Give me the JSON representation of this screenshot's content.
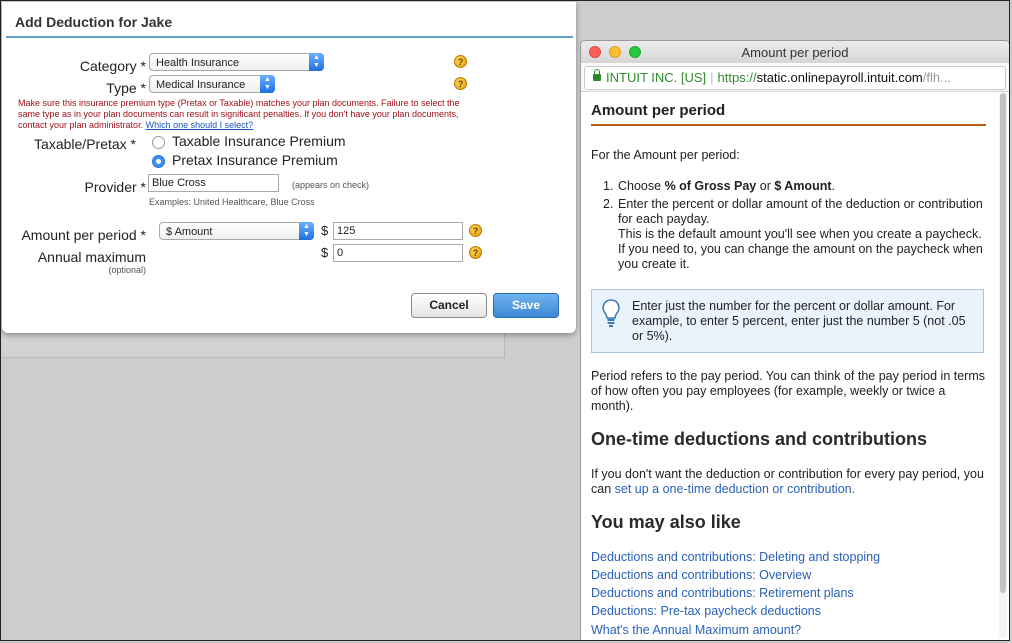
{
  "dialog": {
    "title": "Add Deduction for Jake",
    "category_label": "Category *",
    "category_value": "Health Insurance",
    "type_label": "Type *",
    "type_value": "Medical Insurance",
    "warning": "Make sure this insurance premium type (Pretax or Taxable) matches your plan documents. Failure to select the same type as in your plan documents can result in significant penalties. If you don't have your plan documents, contact your plan administrator.",
    "warning_link": "Which one should I select?",
    "taxable_label": "Taxable/Pretax *",
    "taxable_option": "Taxable Insurance Premium",
    "pretax_option": "Pretax Insurance Premium",
    "provider_label": "Provider *",
    "provider_value": "Blue Cross",
    "provider_note": "(appears on check)",
    "provider_examples": "Examples: United Healthcare, Blue Cross",
    "amount_label": "Amount per period *",
    "amount_type": "$ Amount",
    "currency": "$",
    "amount_value": "125",
    "annual_label": "Annual maximum",
    "annual_optional": "(optional)",
    "annual_value": "0",
    "help_glyph": "?",
    "cancel": "Cancel",
    "save": "Save"
  },
  "popup": {
    "window_title": "Amount per period",
    "url_org": "INTUIT INC. [US]",
    "url_scheme": "https://",
    "url_host": "static.onlinepayroll.intuit.com",
    "url_path": "/flh...",
    "heading": "Amount per period",
    "intro": "For the Amount per period:",
    "step1_num": "1.",
    "step1_pre": "Choose ",
    "step1_bold1": "% of Gross Pay",
    "step1_mid": " or ",
    "step1_bold2": "$ Amount",
    "step1_end": ".",
    "step2_num": "2.",
    "step2_text": "Enter the percent or dollar amount of the deduction or contribution for each payday.",
    "step2_extra": "This is the default amount you'll see when you create a paycheck. If you need to, you can change the amount on the paycheck when you create it.",
    "tip": "Enter just the number for the percent or dollar amount. For example, to enter 5 percent, enter just the number 5 (not .05 or 5%).",
    "period_text": "Period refers to the pay period. You can think of the pay period in terms of how often you pay employees (for example, weekly or twice a month).",
    "onetime_heading": "One-time deductions and contributions",
    "onetime_text": "If you don't want the deduction or contribution for every pay period, you can ",
    "onetime_link": "set up a one-time deduction or contribution.",
    "related_heading": "You may also like",
    "related": [
      "Deductions and contributions: Deleting and stopping",
      "Deductions and contributions: Overview",
      "Deductions and contributions: Retirement plans",
      "Deductions: Pre-tax paycheck deductions",
      "What's the Annual Maximum amount?"
    ]
  }
}
